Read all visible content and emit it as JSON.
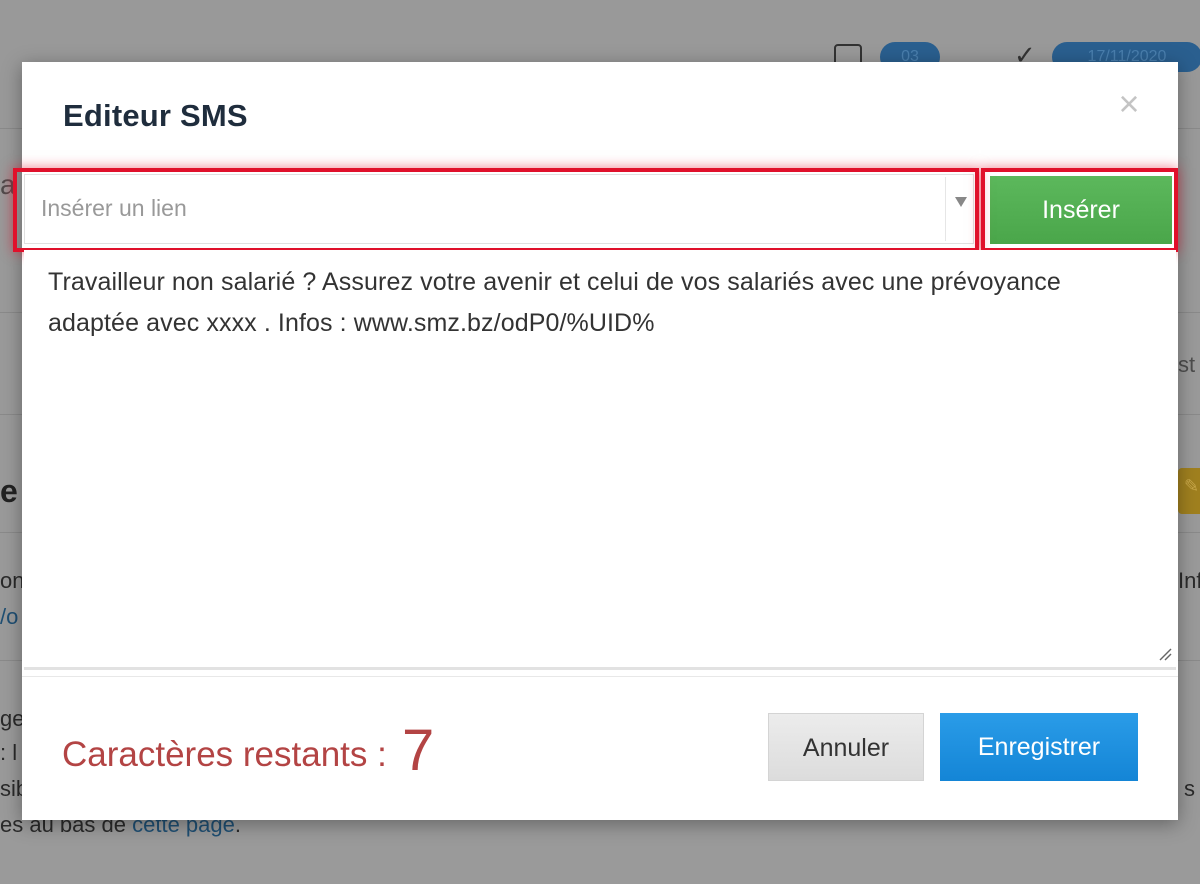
{
  "background": {
    "pill_count": "03",
    "pill_date": "17/11/2020",
    "frag_left_1": "a",
    "frag_right_1": "st",
    "frag_left_2": "e",
    "frag_left_3": "on",
    "frag_right_3": "Inf",
    "frag_left_4": "/o",
    "frag_left_5": "ge",
    "frag_left_6": ": l",
    "frag_left_7": "sib",
    "frag_right_7": "s",
    "bottom_text": "es au bas de ",
    "bottom_link": "cette page",
    "bottom_end": "."
  },
  "modal": {
    "title": "Editeur SMS",
    "close_label": "×",
    "link_select": {
      "placeholder": "Insérer un lien"
    },
    "insert_button": "Insérer",
    "message": "Travailleur non salarié ? Assurez votre avenir et celui de vos salariés avec une prévoyance adaptée avec xxxx . Infos : www.smz.bz/odP0/%UID%",
    "chars_remaining_label": "Caractères restants :",
    "chars_remaining_value": "7",
    "cancel_button": "Annuler",
    "save_button": "Enregistrer"
  },
  "colors": {
    "highlight": "#e0112b",
    "insert_green": "#4aa64a",
    "save_blue": "#1485d6",
    "counter_red": "#b34444"
  }
}
